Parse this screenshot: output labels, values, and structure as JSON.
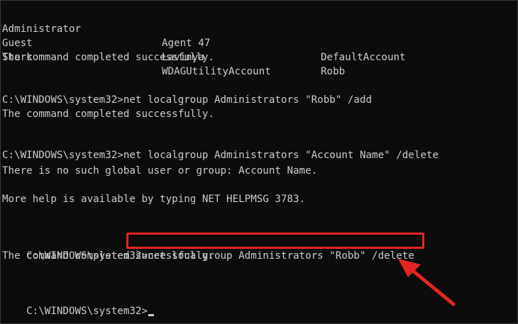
{
  "users_table": {
    "rows": [
      [
        "Administrator",
        "Agent 47",
        "DefaultAccount"
      ],
      [
        "Guest",
        "Lavinya",
        "Robb"
      ],
      [
        "Stark",
        "WDAGUtilityAccount",
        ""
      ]
    ]
  },
  "output": {
    "success_1": "The command completed successfully.",
    "prompt_2": "C:\\WINDOWS\\system32>net localgroup Administrators \"Robb\" /add",
    "success_2": "The command completed successfully.",
    "prompt_3": "C:\\WINDOWS\\system32>net localgroup Administrators \"Account Name\" /delete",
    "error_3": "There is no such global user or group: Account Name.",
    "help_3": "More help is available by typing NET HELPMSG 3783.",
    "prompt_4_path": "C:\\WINDOWS\\system32>",
    "prompt_4_cmd": "net localgroup Administrators \"Robb\" /delete",
    "success_4": "The command completed successfully.",
    "current_prompt": "C:\\WINDOWS\\system32>"
  },
  "colors": {
    "background": "#0c0c0c",
    "text": "#cccccc",
    "annotation": "#e52521"
  }
}
